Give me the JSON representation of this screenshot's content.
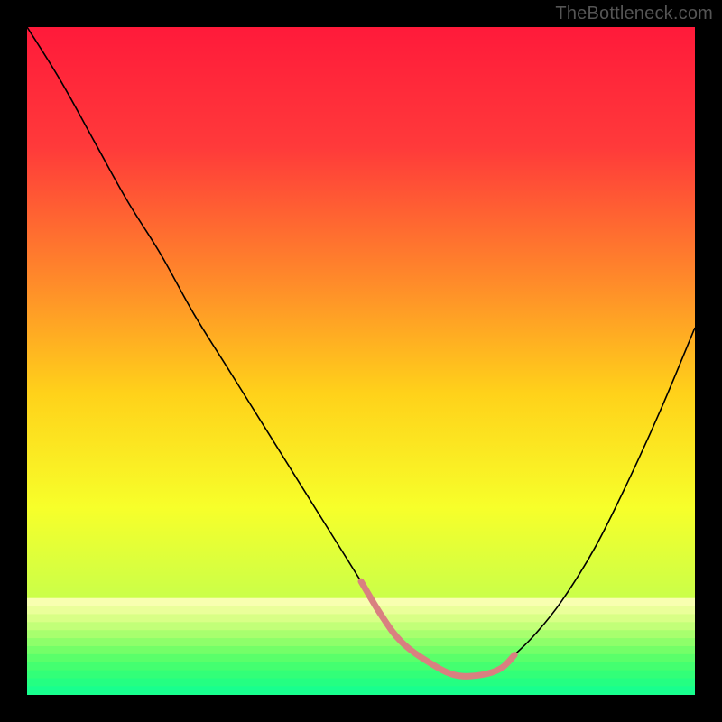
{
  "watermark": "TheBottleneck.com",
  "chart_data": {
    "type": "line",
    "title": "",
    "xlabel": "",
    "ylabel": "",
    "xlim": [
      0,
      100
    ],
    "ylim": [
      0,
      100
    ],
    "background_gradient": {
      "stops": [
        {
          "offset": 0,
          "color": "#ff1a3a"
        },
        {
          "offset": 18,
          "color": "#ff3a3a"
        },
        {
          "offset": 38,
          "color": "#ff8a2a"
        },
        {
          "offset": 55,
          "color": "#ffd21a"
        },
        {
          "offset": 72,
          "color": "#f7ff2a"
        },
        {
          "offset": 86,
          "color": "#c8ff4a"
        },
        {
          "offset": 95,
          "color": "#7fff6a"
        },
        {
          "offset": 100,
          "color": "#2aff7a"
        }
      ]
    },
    "series": [
      {
        "name": "curve",
        "stroke": "#000000",
        "stroke_width": 1.6,
        "x": [
          0,
          5,
          10,
          15,
          20,
          25,
          30,
          35,
          40,
          45,
          50,
          53,
          56,
          60,
          64,
          68,
          71,
          73,
          76,
          80,
          85,
          90,
          95,
          100
        ],
        "y": [
          100,
          92,
          83,
          74,
          66,
          57,
          49,
          41,
          33,
          25,
          17,
          12,
          8,
          5,
          3,
          3,
          4,
          6,
          9,
          14,
          22,
          32,
          43,
          55
        ]
      },
      {
        "name": "trough-highlight",
        "stroke": "#d98080",
        "stroke_width": 7,
        "linecap": "round",
        "x": [
          50,
          53,
          56,
          60,
          64,
          68,
          71,
          73
        ],
        "y": [
          17,
          12,
          8,
          5,
          3,
          3,
          4,
          6
        ]
      }
    ],
    "bottom_band": {
      "y_top": 14.5,
      "stripes": [
        {
          "y0": 14.5,
          "y1": 13.3,
          "color": "#f8ffb0"
        },
        {
          "y0": 13.3,
          "y1": 12.1,
          "color": "#eaff9a"
        },
        {
          "y0": 12.1,
          "y1": 10.9,
          "color": "#d8ff86"
        },
        {
          "y0": 10.9,
          "y1": 9.7,
          "color": "#c2ff78"
        },
        {
          "y0": 9.7,
          "y1": 8.5,
          "color": "#a8ff6e"
        },
        {
          "y0": 8.5,
          "y1": 7.3,
          "color": "#8eff6a"
        },
        {
          "y0": 7.3,
          "y1": 6.1,
          "color": "#74ff68"
        },
        {
          "y0": 6.1,
          "y1": 4.9,
          "color": "#5aff6a"
        },
        {
          "y0": 4.9,
          "y1": 3.7,
          "color": "#44ff70"
        },
        {
          "y0": 3.7,
          "y1": 2.5,
          "color": "#32ff78"
        },
        {
          "y0": 2.5,
          "y1": 1.3,
          "color": "#24ff82"
        },
        {
          "y0": 1.3,
          "y1": 0.0,
          "color": "#18ff8e"
        }
      ]
    }
  }
}
